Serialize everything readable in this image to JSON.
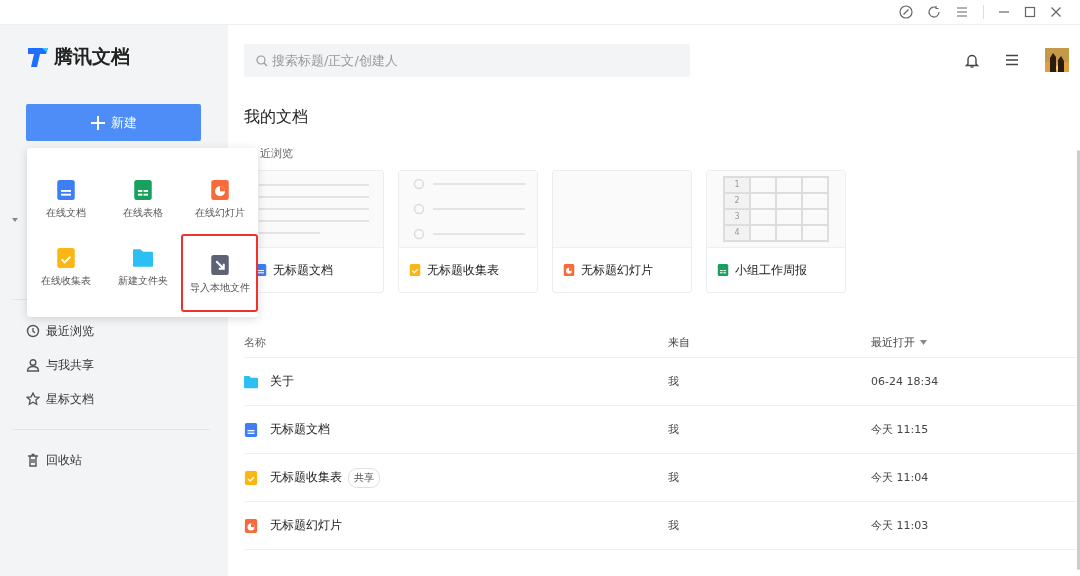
{
  "app": {
    "name": "腾讯文档"
  },
  "new_button": {
    "label": "新建"
  },
  "new_menu": {
    "items": [
      {
        "label": "在线文档",
        "kind": "doc",
        "highlighted": false
      },
      {
        "label": "在线表格",
        "kind": "sheet",
        "highlighted": false
      },
      {
        "label": "在线幻灯片",
        "kind": "slide",
        "highlighted": false
      },
      {
        "label": "在线收集表",
        "kind": "form",
        "highlighted": false
      },
      {
        "label": "新建文件夹",
        "kind": "folder",
        "highlighted": false
      },
      {
        "label": "导入本地文件",
        "kind": "import",
        "highlighted": true
      }
    ]
  },
  "sidebar": {
    "items": [
      {
        "label": "最近浏览",
        "kind": "clock"
      },
      {
        "label": "与我共享",
        "kind": "person"
      },
      {
        "label": "星标文档",
        "kind": "star"
      },
      {
        "label": "回收站",
        "kind": "trash"
      }
    ]
  },
  "search": {
    "placeholder": "搜索标题/正文/创建人"
  },
  "page_title": "我的文档",
  "recent_label": "近浏览",
  "recent_cards": [
    {
      "name": "无标题文档",
      "kind": "doc"
    },
    {
      "name": "无标题收集表",
      "kind": "form"
    },
    {
      "name": "无标题幻灯片",
      "kind": "slide"
    },
    {
      "name": "小组工作周报",
      "kind": "sheet",
      "grid_rows": [
        "1",
        "2",
        "3",
        "4"
      ]
    }
  ],
  "table": {
    "columns": [
      {
        "label": "名称",
        "sorted": false
      },
      {
        "label": "来自",
        "sorted": false
      },
      {
        "label": "最近打开",
        "sorted": true
      }
    ],
    "rows": [
      {
        "name": "关于",
        "kind": "folder",
        "from": "我",
        "opened": "06-24 18:34"
      },
      {
        "name": "无标题文档",
        "kind": "doc",
        "from": "我",
        "opened": "今天 11:15"
      },
      {
        "name": "无标题收集表",
        "kind": "form",
        "tag": "共享",
        "from": "我",
        "opened": "今天 11:04"
      },
      {
        "name": "无标题幻灯片",
        "kind": "slide",
        "from": "我",
        "opened": "今天 11:03"
      }
    ]
  }
}
